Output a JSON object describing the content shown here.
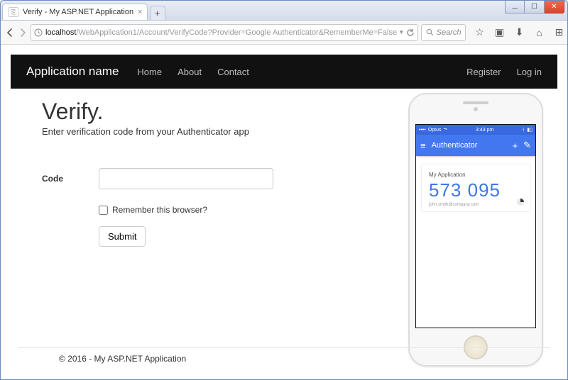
{
  "browser": {
    "tab_title": "Verify - My ASP.NET Application",
    "url_host": "localhost",
    "url_path": "/WebApplication1/Account/VerifyCode?Provider=Google Authenticator&RememberMe=False",
    "search_placeholder": "Search"
  },
  "nav": {
    "brand": "Application name",
    "links": {
      "home": "Home",
      "about": "About",
      "contact": "Contact"
    },
    "register": "Register",
    "login": "Log in"
  },
  "page": {
    "heading": "Verify.",
    "subheading": "Enter verification code from your Authenticator app",
    "code_label": "Code",
    "code_value": "",
    "remember_label": "Remember this browser?",
    "submit_label": "Submit"
  },
  "phone": {
    "carrier": "Optus",
    "time": "3:43 pm",
    "app_title": "Authenticator",
    "card_app": "My Application",
    "card_code": "573 095",
    "card_email": "john.smith@company.com"
  },
  "footer": "© 2016 - My ASP.NET Application"
}
